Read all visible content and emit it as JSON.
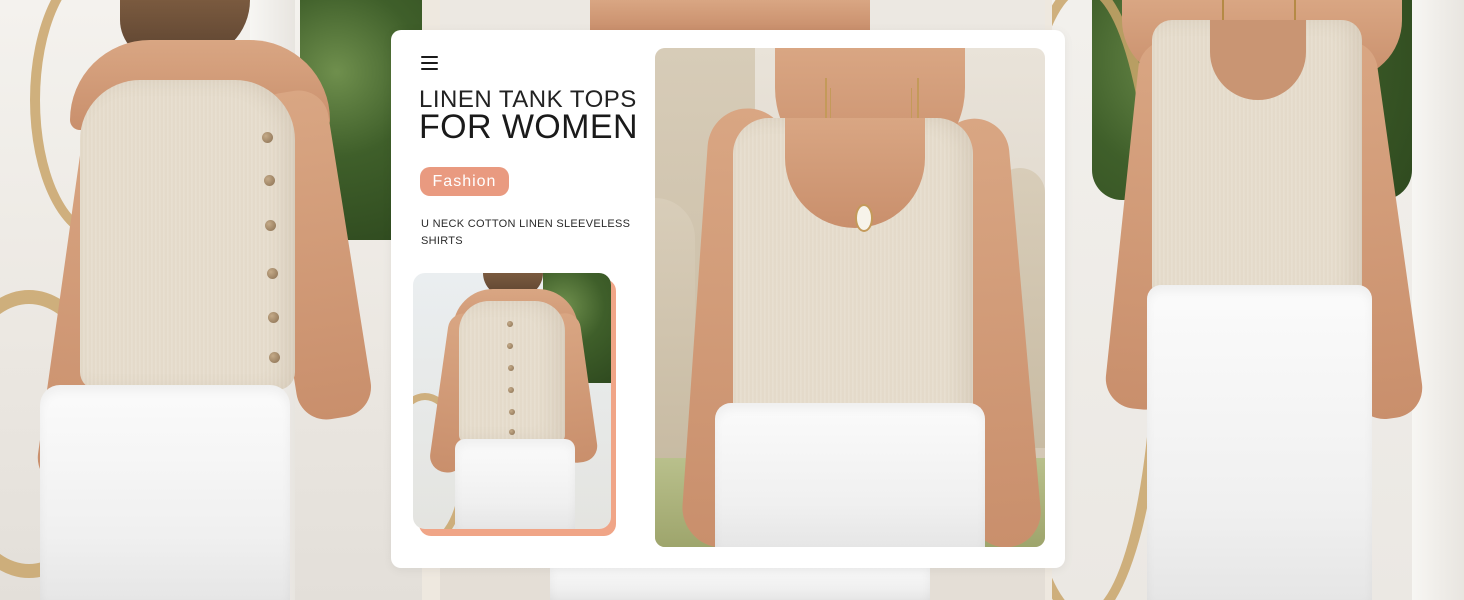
{
  "header": {
    "title_line_1": "LINEN TANK TOPS",
    "title_line_2": "FOR WOMEN"
  },
  "tag": {
    "label": "Fashion",
    "color": "#e99a80"
  },
  "subtitle": "U NECK COTTON LINEN SLEEVELESS SHIRTS",
  "icons": {
    "menu": "hamburger-menu-icon"
  },
  "colors": {
    "accent": "#e99a80",
    "card_background": "#ffffff",
    "text": "#1a1a1a"
  }
}
